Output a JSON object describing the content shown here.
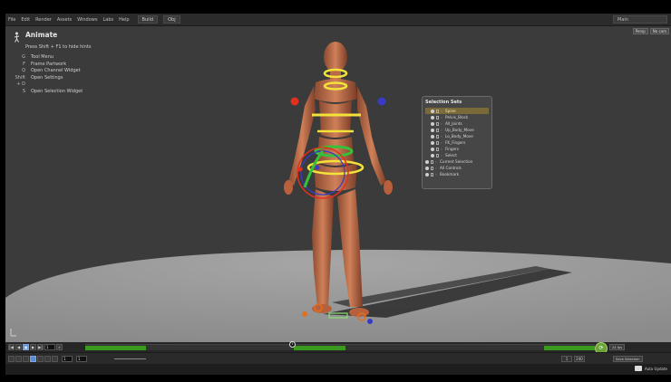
{
  "menubar": {
    "items": [
      "File",
      "Edit",
      "Render",
      "Assets",
      "Windows",
      "Labs",
      "Help"
    ],
    "desktop": "Build",
    "desktop_value": "Obj",
    "right_value": "Main"
  },
  "hud": {
    "title": "Animate",
    "hint": "Press Shift + F1 to hide hints",
    "shortcuts": [
      {
        "key": "G",
        "desc": "Tool Menu"
      },
      {
        "key": "F",
        "desc": "Frame Partwork"
      },
      {
        "key": "Q",
        "desc": "Open Channel Widget"
      },
      {
        "key": "Shift + D",
        "desc": "Open Settings"
      },
      {
        "key": "S",
        "desc": "Open Selection Widget"
      }
    ]
  },
  "viewport_controls": [
    "Persp",
    "No cam"
  ],
  "selection_sets": {
    "title": "Selection Sets",
    "rows": [
      {
        "label": "Spine",
        "active": true
      },
      {
        "label": "Pelvis_Block",
        "active": false
      },
      {
        "label": "All_Joints",
        "active": false
      },
      {
        "label": "Up_Body_Move",
        "active": false
      },
      {
        "label": "Lo_Body_Move",
        "active": false
      },
      {
        "label": "FK_Fingers",
        "active": false
      },
      {
        "label": "Fingers",
        "active": false
      },
      {
        "label": "Select",
        "active": false
      },
      {
        "label": "Current Selection",
        "active": false
      },
      {
        "label": "All Controls",
        "active": false
      },
      {
        "label": "Bookmark",
        "active": false
      }
    ]
  },
  "timeline": {
    "frame": "1",
    "playhead_label": "1",
    "key_segments": [
      [
        0,
        0.12
      ],
      [
        0.41,
        0.51
      ],
      [
        0.9,
        1.0
      ]
    ],
    "right_fields": [
      "24 fps",
      "Save Selection"
    ]
  },
  "bottombar": {
    "start": "1",
    "range_start": "1",
    "end_a": "1",
    "end_b": "240"
  },
  "status": {
    "text": "Auto Update"
  },
  "colors": {
    "viewport_bg": "#3b3b3b",
    "floor": "#9c9c9c",
    "figure": "#c8724e",
    "control_yellow": "#f2e23a",
    "control_red": "#e03020",
    "control_green": "#35c23a",
    "control_blue": "#3a3ac8",
    "key_green": "#3a9a1f"
  }
}
